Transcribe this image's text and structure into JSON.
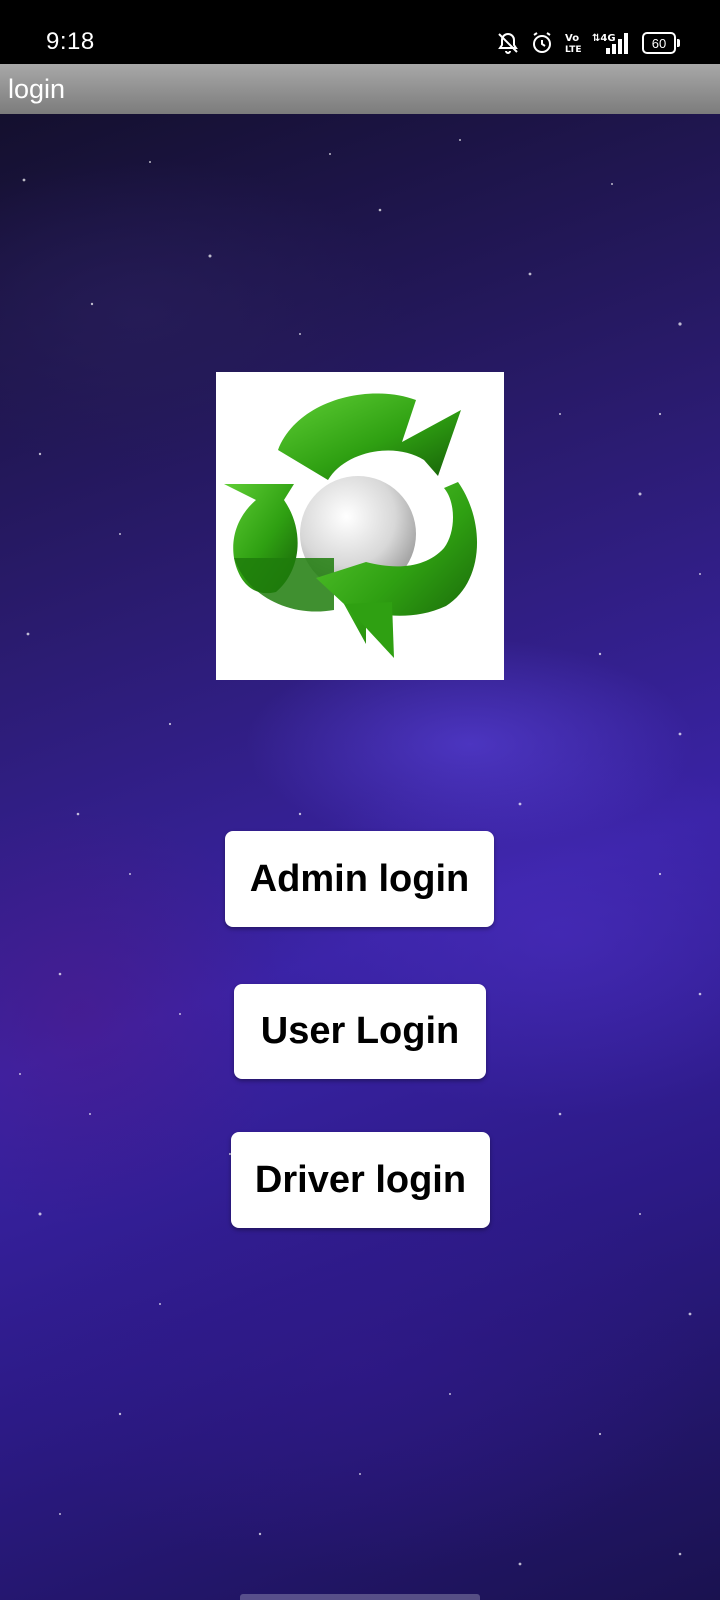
{
  "status_bar": {
    "time": "9:18",
    "icons": [
      "notifications-off-icon",
      "alarm-icon",
      "volte-icon",
      "signal-4g-icon"
    ],
    "volte_label": "Vo LTE",
    "network_label": "4G",
    "battery_level": "60"
  },
  "app_bar": {
    "title": "login"
  },
  "logo": {
    "icon": "recycle-icon",
    "colors": {
      "primary": "#2fa012",
      "dark": "#1a6b0a",
      "center": "#e6e6e6"
    }
  },
  "buttons": {
    "admin_login": "Admin login",
    "user_login": "User Login",
    "driver_login": "Driver login"
  },
  "colors": {
    "background_accent": "#3a23a6",
    "app_bar": "#8f8f8f",
    "button_bg": "#ffffff"
  }
}
